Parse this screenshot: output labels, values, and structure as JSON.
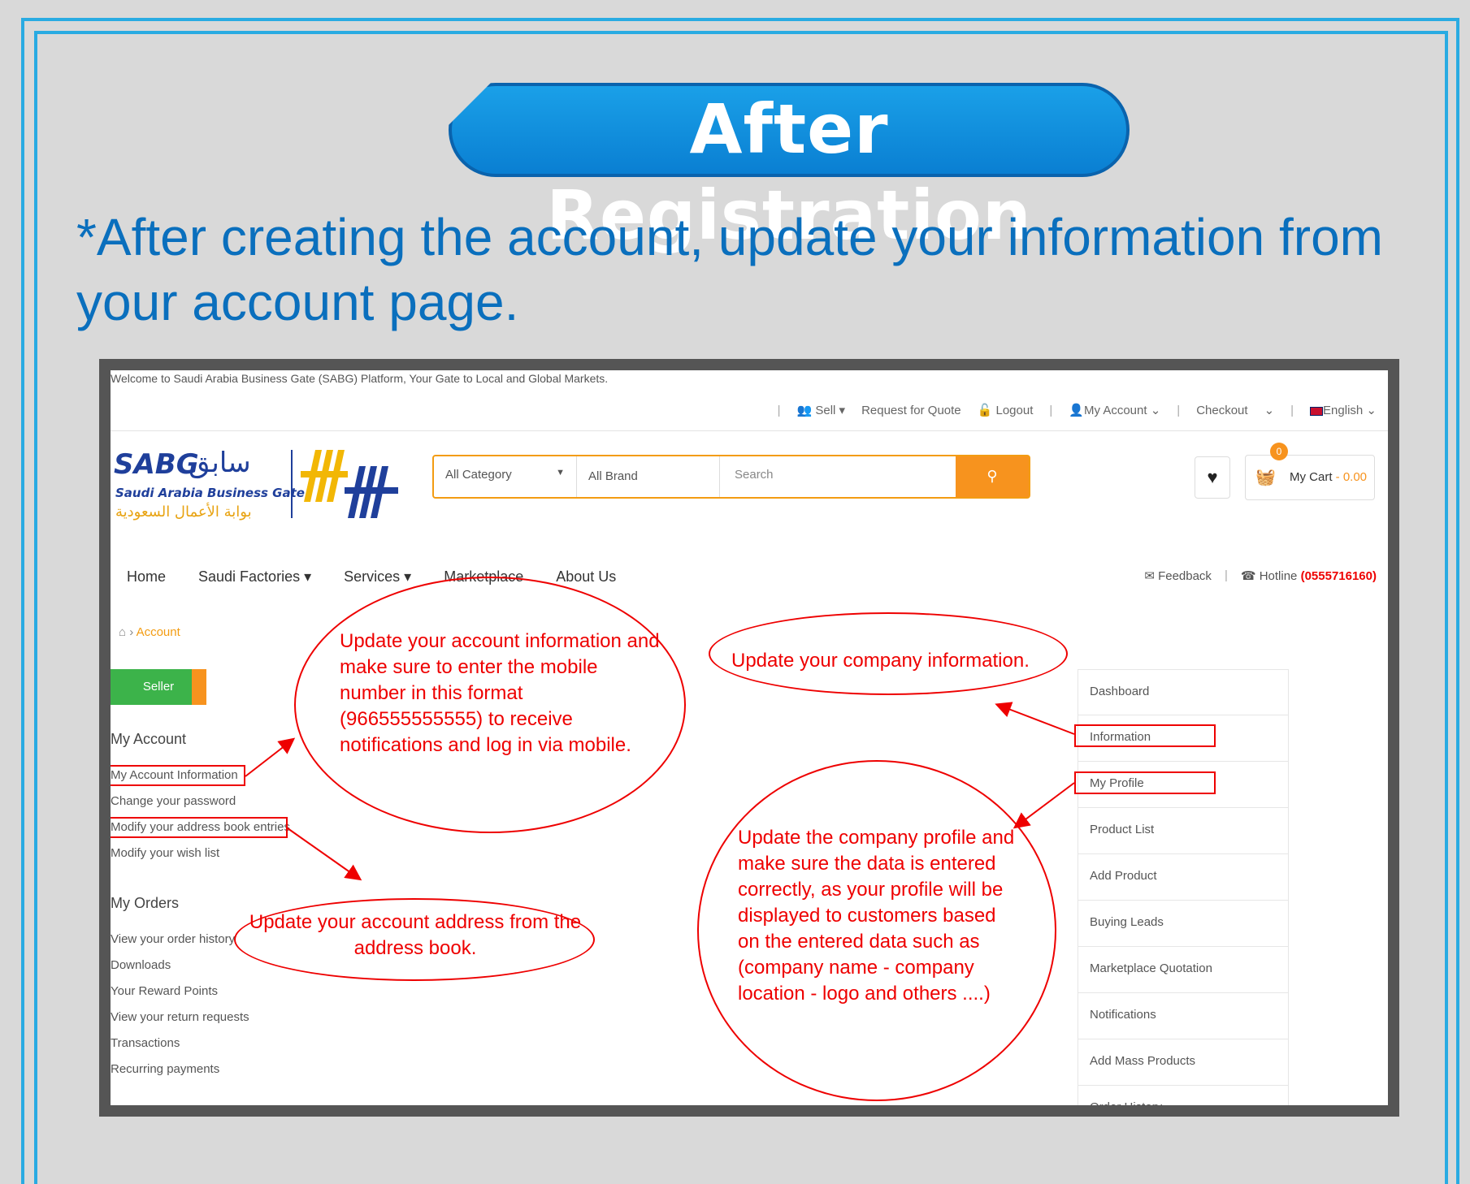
{
  "slide": {
    "title": "After Registration",
    "intro": "*After creating the account, update your information from your account page."
  },
  "site": {
    "welcome": "Welcome to Saudi Arabia Business Gate (SABG) Platform, Your Gate to Local and Global Markets.",
    "topbar": {
      "sell": "Sell",
      "rfq": "Request for Quote",
      "logout": "Logout",
      "account": "My Account",
      "checkout": "Checkout",
      "language": "English"
    },
    "logo": {
      "en": "SABG",
      "ar": "سابق",
      "sub": "Saudi Arabia Business Gate",
      "ar_sub": "بوابة الأعمال السعودية"
    },
    "search": {
      "category": "All Category",
      "brand": "All Brand",
      "placeholder": "Search"
    },
    "cart": {
      "badge": "0",
      "label": "My Cart",
      "amount": "- 0.00"
    },
    "nav": [
      "Home",
      "Saudi Factories",
      "Services",
      "Marketplace",
      "About Us"
    ],
    "feedback": "Feedback",
    "hotline_label": "Hotline",
    "hotline_number": "(0555716160)",
    "breadcrumb": "Account",
    "seller": "Seller",
    "my_account": {
      "heading": "My Account",
      "links": [
        "My Account Information",
        "Change your password",
        "Modify your address book entries",
        "Modify your wish list"
      ]
    },
    "my_orders": {
      "heading": "My Orders",
      "links": [
        "View your order history",
        "Downloads",
        "Your Reward Points",
        "View your return requests",
        "Transactions",
        "Recurring payments"
      ]
    },
    "right_menu": [
      "Dashboard",
      "Information",
      "My Profile",
      "Product List",
      "Add Product",
      "Buying Leads",
      "Marketplace Quotation",
      "Notifications",
      "Add Mass Products",
      "Order History"
    ]
  },
  "annotations": {
    "account_info": "Update your account information and make sure to enter the mobile number in this format (966555555555) to receive notifications and log in via mobile.",
    "company_info": "Update your company information.",
    "address": "Update your account address from the address book.",
    "profile": "Update the company profile and make sure the data is entered correctly, as your profile will be displayed to customers based on the entered data such as (company name - company location - logo and others ....)"
  },
  "colors": {
    "frame": "#29abe2",
    "title_bg": "#0a7fd2",
    "intro_text": "#0a6fbd",
    "accent": "#f7931e",
    "annotation": "#ee0000"
  }
}
